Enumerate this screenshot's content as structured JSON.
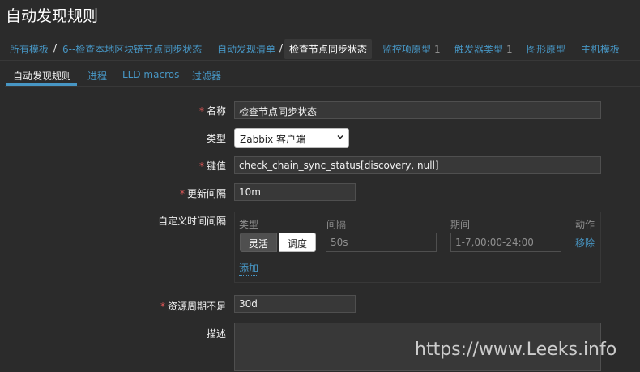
{
  "page": {
    "title": "自动发现规则"
  },
  "breadcrumb": {
    "items": [
      {
        "label": "所有模板"
      },
      {
        "label": "6--检查本地区块链节点同步状态"
      },
      {
        "label": "自动发现清单"
      },
      {
        "label": "检查节点同步状态"
      },
      {
        "label": "监控项原型",
        "count": "1"
      },
      {
        "label": "触发器类型",
        "count": "1"
      },
      {
        "label": "图形原型"
      },
      {
        "label": "主机模板"
      }
    ],
    "separator": "/"
  },
  "tabs": [
    {
      "label": "自动发现规则"
    },
    {
      "label": "进程"
    },
    {
      "label": "LLD macros"
    },
    {
      "label": "过滤器"
    }
  ],
  "form": {
    "required_mark": "*",
    "name": {
      "label": "名称",
      "value": "检查节点同步状态"
    },
    "type": {
      "label": "类型",
      "value": "Zabbix 客户端"
    },
    "key": {
      "label": "键值",
      "value": "check_chain_sync_status[discovery, null]"
    },
    "update_interval": {
      "label": "更新间隔",
      "value": "10m"
    },
    "custom_intervals": {
      "label": "自定义时间间隔",
      "headers": {
        "type": "类型",
        "interval": "间隔",
        "period": "期间",
        "action": "动作"
      },
      "row": {
        "flexible_label": "灵活",
        "scheduling_label": "调度",
        "interval_value": "50s",
        "period_value": "1-7,00:00-24:00",
        "remove_label": "移除"
      },
      "add_label": "添加"
    },
    "lifetime": {
      "label": "资源周期不足",
      "value": "30d"
    },
    "description": {
      "label": "描述",
      "value": ""
    }
  },
  "watermark": "https://www.Leeks.info",
  "colors": {
    "accent": "#4796c4",
    "required": "#e45959",
    "background": "#2b2b2b"
  }
}
